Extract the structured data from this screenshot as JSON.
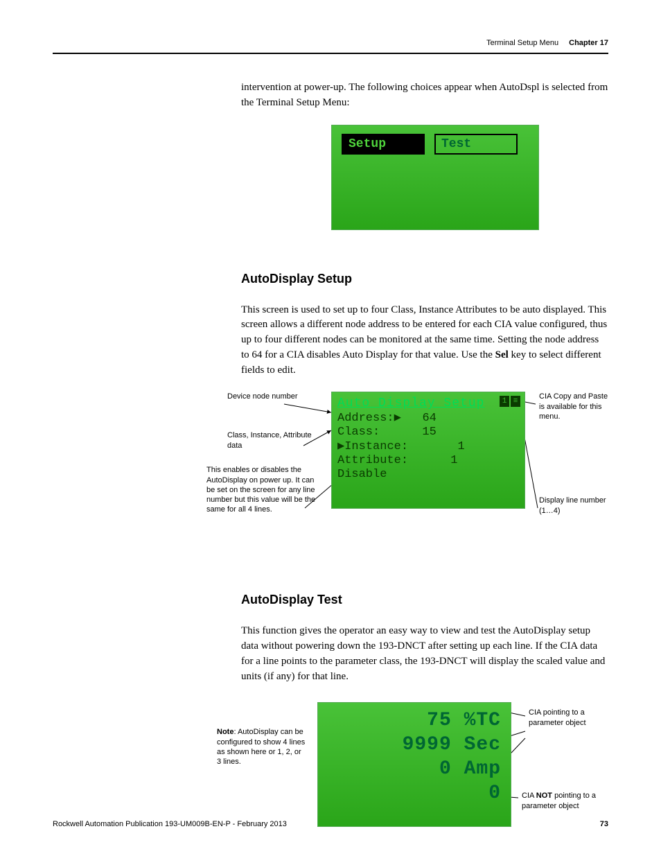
{
  "header": {
    "section": "Terminal Setup Menu",
    "chapter": "Chapter 17"
  },
  "intro": "intervention at power-up. The following choices appear when AutoDspl is selected from the Terminal Setup Menu:",
  "lcd1": {
    "btn1": "Setup",
    "btn2": "Test"
  },
  "section1": {
    "title": "AutoDisplay Setup",
    "body_pre": "This screen is used to set up to four Class, Instance Attributes to be auto displayed. This screen allows a different node address to be entered for each CIA value configured, thus up to four different nodes can be monitored at the same time. Setting the node address to 64 for a CIA disables Auto Display for that value. Use the ",
    "body_bold": "Sel",
    "body_post": " key to select different fields to edit."
  },
  "lcd2": {
    "title": "Auto Display Setup",
    "rows": {
      "address": "Address:▶   64",
      "class": "Class:      15",
      "instance": "▶Instance:       1",
      "attribute": "Attribute:      1",
      "disable": "Disable"
    },
    "corner1": "1",
    "corner2": "≡"
  },
  "callouts1": {
    "node": "Device node number",
    "cia": "Class, Instance, Attribute data",
    "enable": "This enables or disables the AutoDisplay on power up. It can be set on the screen for any line number but this value will be the same for all 4 lines.",
    "copy": "CIA Copy and Paste is available for this menu.",
    "display": "Display line number (1…4)"
  },
  "section2": {
    "title": "AutoDisplay Test",
    "body": "This function gives the operator an easy way to view and test the AutoDisplay setup data without powering down the 193-DNCT after setting up each line. If the CIA data for a line points to the parameter class, the 193-DNCT will display the scaled value and units (if any) for that line."
  },
  "callouts2": {
    "note_bold": "Note",
    "note": ": AutoDisplay can be configured to show 4 lines as shown here or 1, 2, or 3 lines.",
    "param": "CIA pointing to a parameter object",
    "notparam_pre": "CIA ",
    "notparam_bold": "NOT",
    "notparam_post": " pointing to a parameter object"
  },
  "lcd3": {
    "l1": "75 %TC",
    "l2": "9999 Sec",
    "l3": "0 Amp",
    "l4": "0"
  },
  "footer": {
    "pub": "Rockwell Automation Publication 193-UM009B-EN-P - February 2013",
    "page": "73"
  }
}
